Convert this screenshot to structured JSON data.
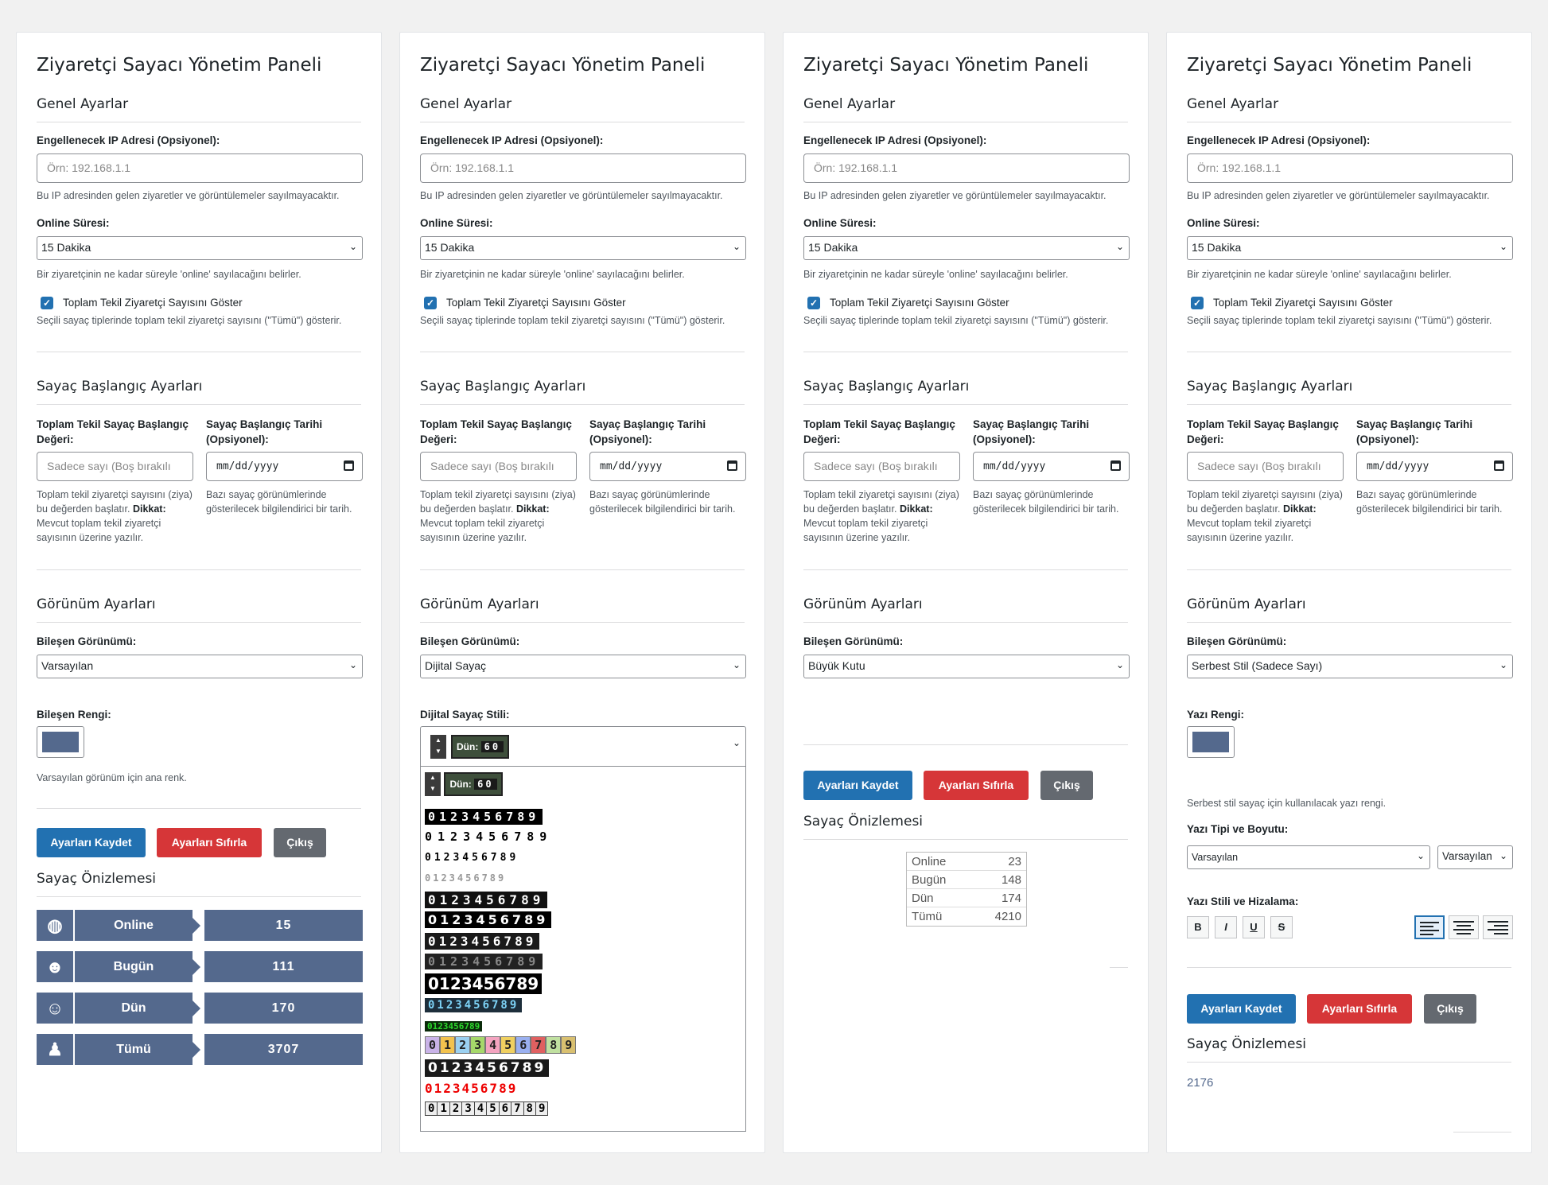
{
  "panel": {
    "title": "Ziyaretçi Sayacı Yönetim Paneli",
    "general": {
      "heading": "Genel Ayarlar",
      "ip_label": "Engellenecek IP Adresi (Opsiyonel):",
      "ip_placeholder": "Örn: 192.168.1.1",
      "ip_desc": "Bu IP adresinden gelen ziyaretler ve görüntülemeler sayılmayacaktır.",
      "online_label": "Online Süresi:",
      "online_value": "15 Dakika",
      "online_desc": "Bir ziyaretçinin ne kadar süreyle 'online' sayılacağını belirler.",
      "total_checkbox_label": "Toplam Tekil Ziyaretçi Sayısını Göster",
      "total_checkbox_checked": true,
      "total_desc": "Seçili sayaç tiplerinde toplam tekil ziyaretçi sayısını (\"Tümü\") gösterir."
    },
    "start": {
      "heading": "Sayaç Başlangıç Ayarları",
      "value_label_1": "Toplam Tekil Sayaç Başlangıç",
      "value_label_2": "Değeri:",
      "value_placeholder": "Sadece sayı (Boş bırakılı",
      "value_desc_1": "Toplam tekil ziyaretçi sayısını (ziya)",
      "value_desc_2a": "bu değerden başlatır.",
      "value_desc_2b": "Dikkat:",
      "value_desc_3": "Mevcut toplam tekil ziyaretçi",
      "value_desc_4": "sayısının üzerine yazılır.",
      "date_label_1": "Sayaç Başlangıç Tarihi",
      "date_label_2": "(Opsiyonel):",
      "date_placeholder": "mm/dd/yyyy",
      "date_desc_1": "Bazı sayaç görünümlerinde",
      "date_desc_2": "gösterilecek bilgilendirici bir tarih."
    },
    "view": {
      "heading": "Görünüm Ayarları",
      "component_label": "Bileşen Görünümü:",
      "color_label": "Bileşen Rengi:",
      "color_value": "#54698d",
      "color_desc": "Varsayılan görünüm için ana renk.",
      "digital_style_label": "Dijital Sayaç Stili:",
      "text_color_label": "Yazı Rengi:",
      "text_color_desc": "Serbest stil sayaç için kullanılacak yazı rengi.",
      "font_label": "Yazı Tipi ve Boyutu:",
      "font_value": "Varsayılan",
      "size_value": "Varsayılan",
      "style_label": "Yazı Stili ve Hizalama:"
    },
    "buttons": {
      "save": "Ayarları Kaydet",
      "reset": "Ayarları Sıfırla",
      "exit": "Çıkış"
    },
    "preview_heading": "Sayaç Önizlemesi"
  },
  "panels": [
    {
      "component": "Varsayılan"
    },
    {
      "component": "Dijital Sayaç"
    },
    {
      "component": "Büyük Kutu"
    },
    {
      "component": "Serbest Stil (Sadece Sayı)"
    }
  ],
  "preview_default": [
    {
      "label": "Online",
      "value": "15",
      "icon": "globe-icon"
    },
    {
      "label": "Bugün",
      "value": "111",
      "icon": "person-icon"
    },
    {
      "label": "Dün",
      "value": "170",
      "icon": "person-badge-icon"
    },
    {
      "label": "Tümü",
      "value": "3707",
      "icon": "group-icon"
    }
  ],
  "digital": {
    "selected_label": "Dün:",
    "selected_digits": "60",
    "digits": "0123456789"
  },
  "preview_bigbox": [
    {
      "label": "Online",
      "value": "23"
    },
    {
      "label": "Bugün",
      "value": "148"
    },
    {
      "label": "Dün",
      "value": "174"
    },
    {
      "label": "Tümü",
      "value": "4210"
    }
  ],
  "preview_free": "2176",
  "toolbar": {
    "bold": "B",
    "italic": "I",
    "underline": "U",
    "strike": "S"
  }
}
